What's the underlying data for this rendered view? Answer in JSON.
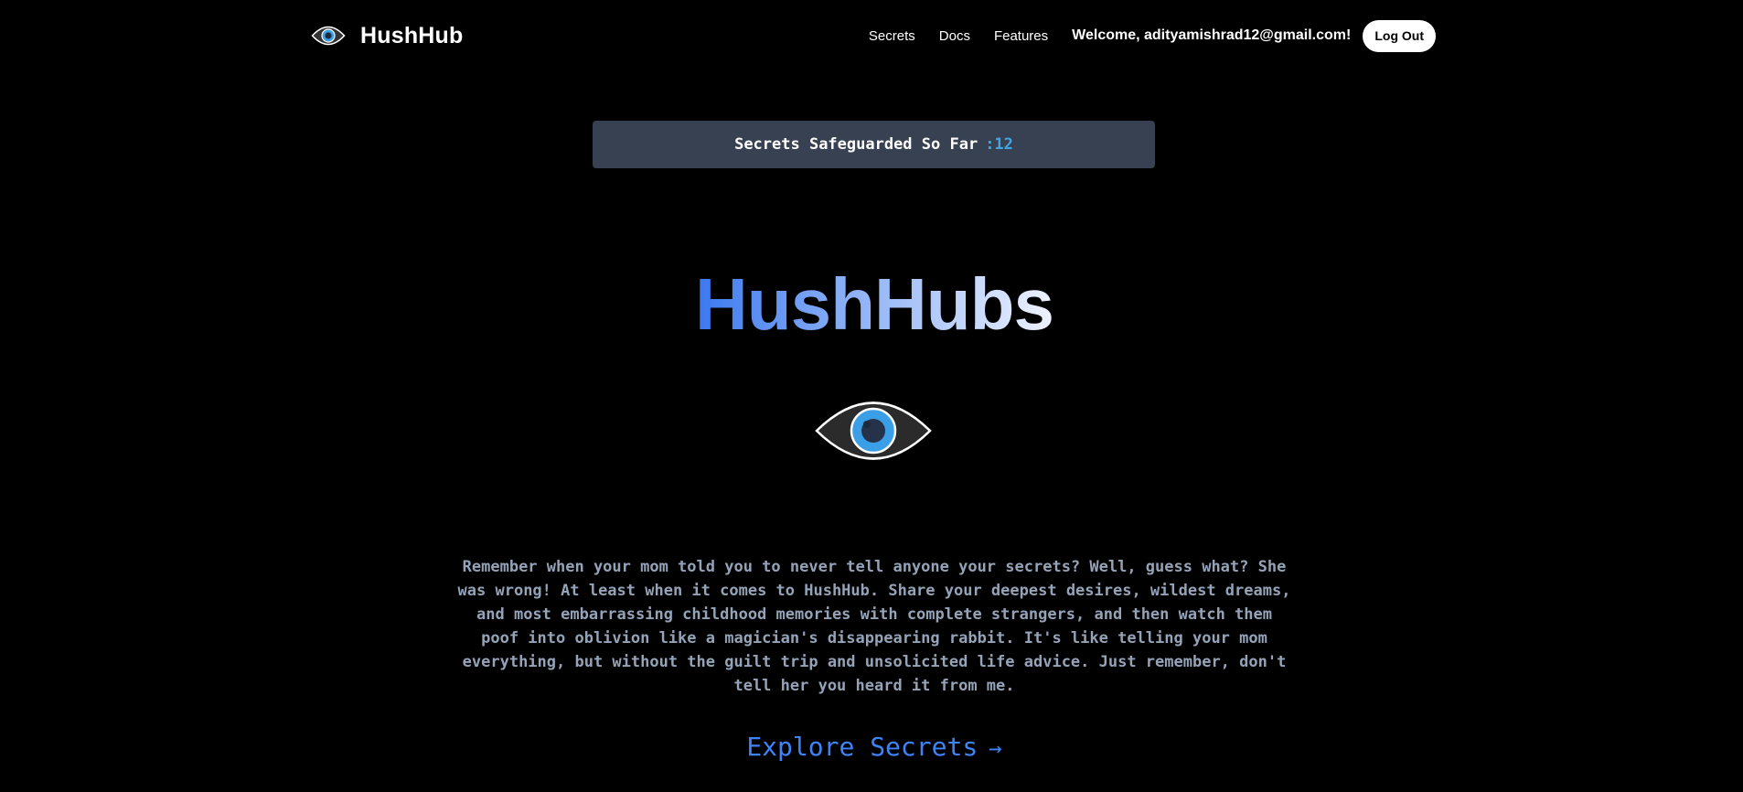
{
  "app": {
    "brand_name": "HushHub"
  },
  "nav": {
    "links": [
      "Secrets",
      "Docs",
      "Features"
    ],
    "welcome": "Welcome, adityamishrad12@gmail.com!",
    "logout_label": "Log Out"
  },
  "counter": {
    "label": "Secrets Safeguarded So Far",
    "value": ":12"
  },
  "hero": {
    "title": "HushHubs",
    "description": "Remember when your mom told you to never tell anyone your secrets? Well, guess what? She was wrong! At least when it comes to HushHub. Share your deepest desires, wildest dreams, and most embarrassing childhood memories with complete strangers, and then watch them poof into oblivion like a magician's disappearing rabbit. It's like telling your mom everything, but without the guilt trip and unsolicited life advice. Just remember, don't tell her you heard it from me.",
    "cta_label": "Explore Secrets",
    "cta_arrow": "→"
  },
  "icons": {
    "brand_logo": "eye-icon",
    "hero_logo": "eye-icon"
  },
  "colors": {
    "background": "#000000",
    "counter_bg": "#374151",
    "counter_value": "#3ea6e6",
    "description": "#94a3b8",
    "cta": "#3f83f8",
    "title_gradient_start": "#3b78f0",
    "title_gradient_end": "#eef2ff"
  }
}
